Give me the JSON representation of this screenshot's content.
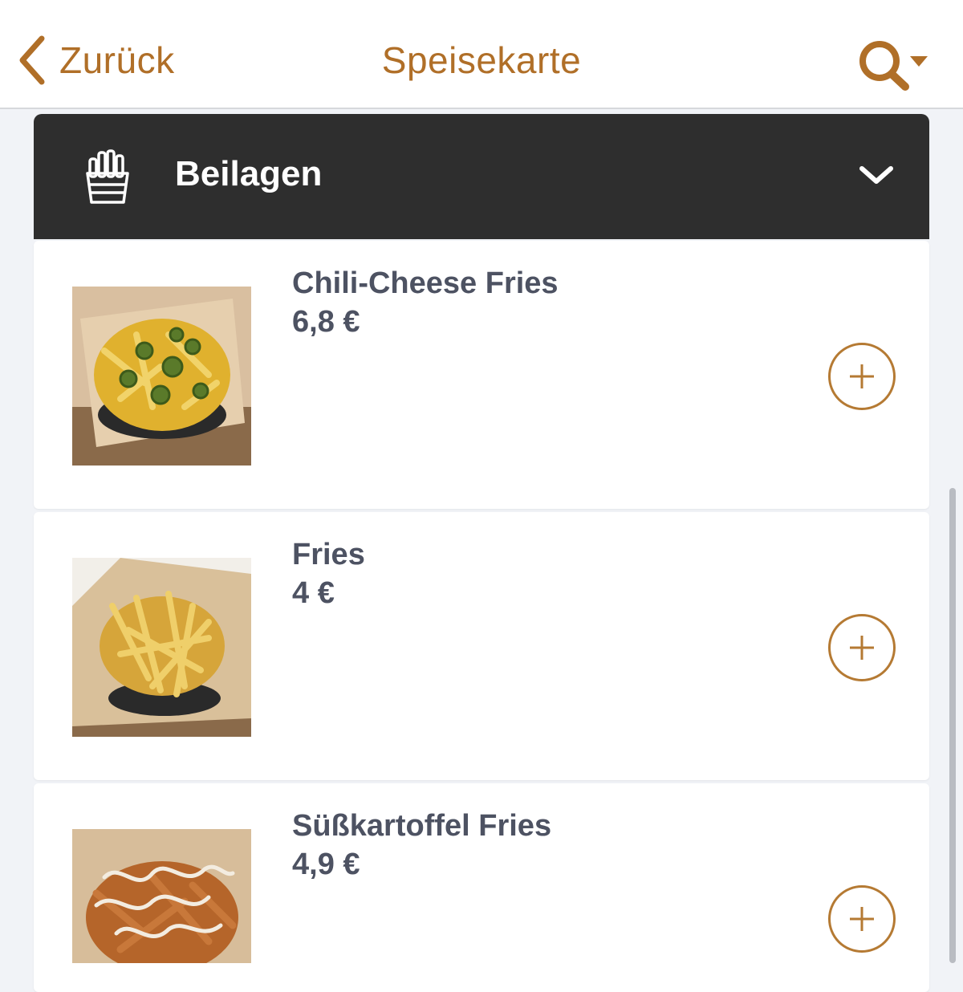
{
  "navbar": {
    "back_label": "Zurück",
    "title": "Speisekarte",
    "accent_color": "#b06f28"
  },
  "category": {
    "label": "Beilagen",
    "icon": "fries-icon",
    "background": "#2e2e2e"
  },
  "items": [
    {
      "name": "Chili-Cheese Fries",
      "price": "6,8 €",
      "image": "chili-cheese-fries-photo"
    },
    {
      "name": "Fries",
      "price": "4 €",
      "image": "fries-photo"
    },
    {
      "name": "Süßkartoffel Fries",
      "price": "4,9 €",
      "image": "sweet-potato-fries-photo"
    }
  ],
  "icons": {
    "back": "chevron-left-icon",
    "search": "search-icon",
    "search_dropdown": "caret-down-icon",
    "collapse": "chevron-down-icon",
    "add": "plus-circle-icon"
  }
}
